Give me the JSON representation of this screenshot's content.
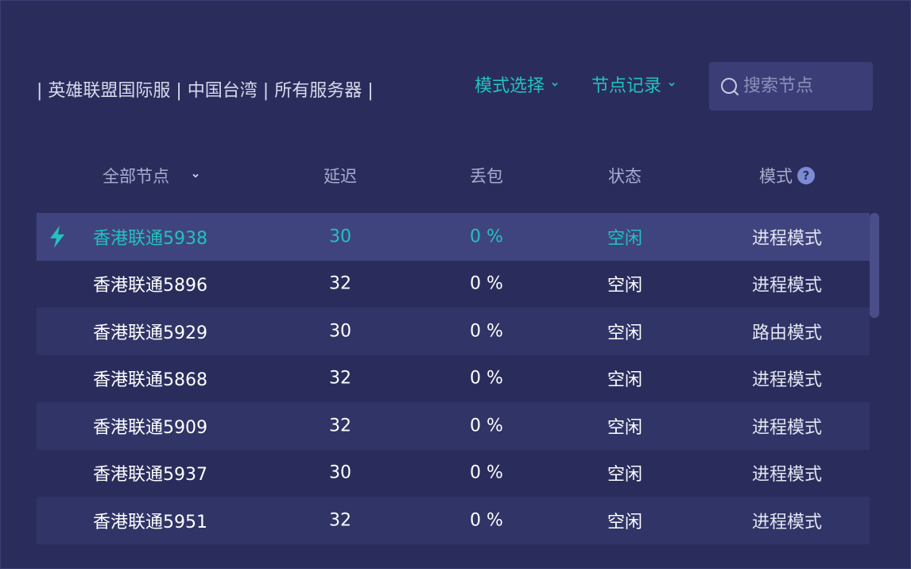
{
  "breadcrumb": "| 英雄联盟国际服 | 中国台湾 | 所有服务器 |",
  "mode_select": {
    "label": "模式选择"
  },
  "node_history": {
    "label": "节点记录"
  },
  "search": {
    "placeholder": "搜索节点",
    "value": ""
  },
  "table": {
    "headers": {
      "node": "全部节点",
      "latency": "延迟",
      "loss": "丢包",
      "status": "状态",
      "mode": "模式"
    },
    "rows": [
      {
        "name": "香港联通5938",
        "latency": "30",
        "loss": "0 %",
        "status": "空闲",
        "mode": "进程模式",
        "selected": true
      },
      {
        "name": "香港联通5896",
        "latency": "32",
        "loss": "0 %",
        "status": "空闲",
        "mode": "进程模式"
      },
      {
        "name": "香港联通5929",
        "latency": "30",
        "loss": "0 %",
        "status": "空闲",
        "mode": "路由模式"
      },
      {
        "name": "香港联通5868",
        "latency": "32",
        "loss": "0 %",
        "status": "空闲",
        "mode": "进程模式"
      },
      {
        "name": "香港联通5909",
        "latency": "32",
        "loss": "0 %",
        "status": "空闲",
        "mode": "进程模式"
      },
      {
        "name": "香港联通5937",
        "latency": "30",
        "loss": "0 %",
        "status": "空闲",
        "mode": "进程模式"
      },
      {
        "name": "香港联通5951",
        "latency": "32",
        "loss": "0 %",
        "status": "空闲",
        "mode": "进程模式"
      }
    ]
  },
  "icons": {
    "selected_row": "lightning-bolt-icon",
    "search": "search-icon",
    "dropdown": "chevron-down-icon",
    "help": "question-circle-icon"
  },
  "colors": {
    "background": "#2a2d5c",
    "accent": "#23c1bd",
    "row_alt": "#303466",
    "row_selected": "#40447e",
    "search_bg": "#3a3d76",
    "help_icon": "#7b8bd4"
  }
}
